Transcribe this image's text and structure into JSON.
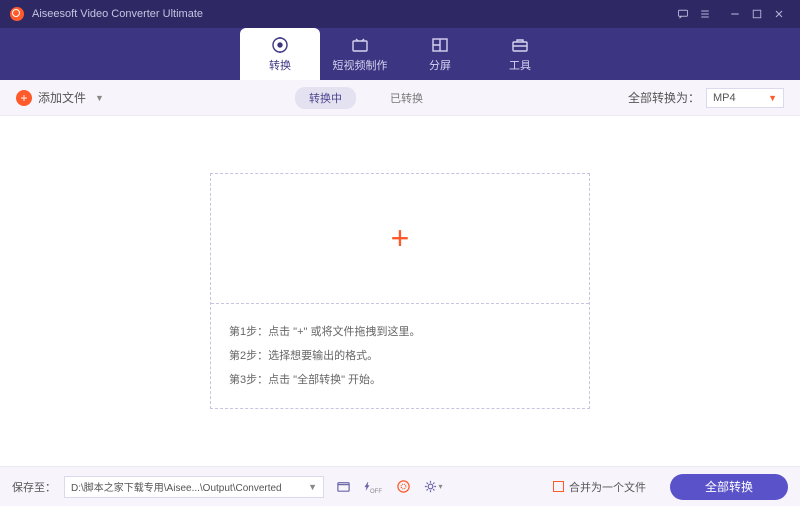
{
  "titlebar": {
    "title": "Aiseesoft Video Converter Ultimate"
  },
  "nav": {
    "tabs": [
      {
        "label": "转换"
      },
      {
        "label": "短视频制作"
      },
      {
        "label": "分屏"
      },
      {
        "label": "工具"
      }
    ]
  },
  "toolbar": {
    "add_label": "添加文件",
    "status_converting": "转换中",
    "status_done": "已转换",
    "convert_all_label": "全部转换为：",
    "format_value": "MP4"
  },
  "dropzone": {
    "step1": "第1步：点击 \"+\" 或将文件拖拽到这里。",
    "step2": "第2步：选择想要输出的格式。",
    "step3": "第3步：点击 \"全部转换\" 开始。"
  },
  "footer": {
    "save_label": "保存至：",
    "path_value": "D:\\脚本之家下载专用\\Aisee...\\Output\\Converted",
    "merge_label": "合并为一个文件",
    "convert_btn": "全部转换"
  }
}
